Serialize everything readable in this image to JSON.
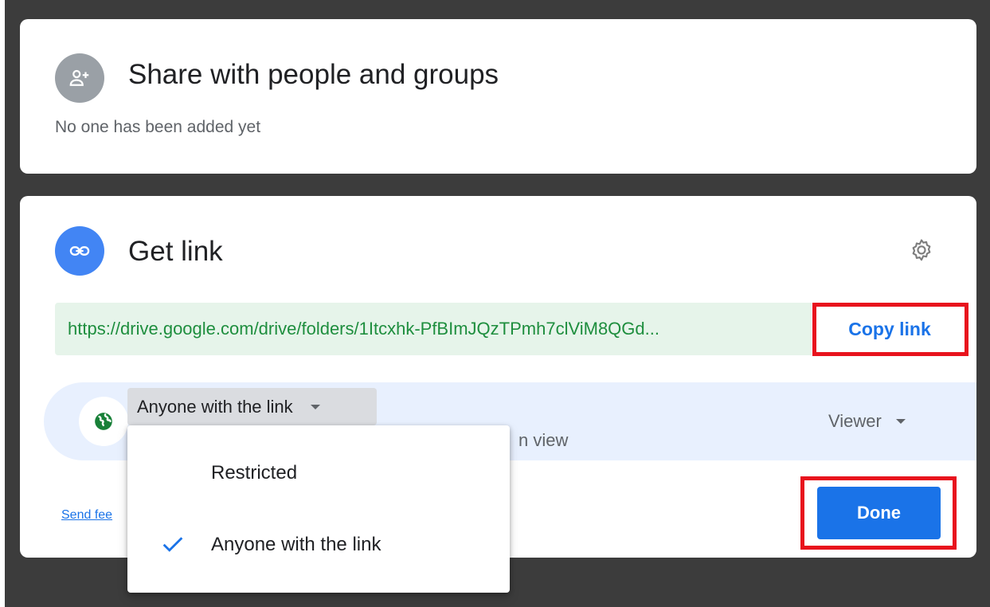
{
  "share_section": {
    "title": "Share with people and groups",
    "subtitle": "No one has been added yet"
  },
  "link_section": {
    "title": "Get link",
    "url": "https://drive.google.com/drive/folders/1Itcxhk-PfBImJQzTPmh7clViM8QGd...",
    "copy_button": "Copy link",
    "access_option": "Anyone with the link",
    "access_description_visible": "n view",
    "role": "Viewer",
    "send_feedback": "Send fee",
    "done_button": "Done"
  },
  "dropdown": {
    "items": [
      {
        "label": "Restricted",
        "selected": false
      },
      {
        "label": "Anyone with the link",
        "selected": true
      }
    ]
  },
  "colors": {
    "accent": "#1a73e8",
    "url_green": "#1e8e3e",
    "url_bg": "#e6f4ea",
    "highlight_red": "#e8131d",
    "backdrop": "#3c3c3c"
  },
  "icons": [
    "person-add-icon",
    "link-icon",
    "gear-icon",
    "globe-icon",
    "check-icon",
    "caret-down-icon"
  ]
}
